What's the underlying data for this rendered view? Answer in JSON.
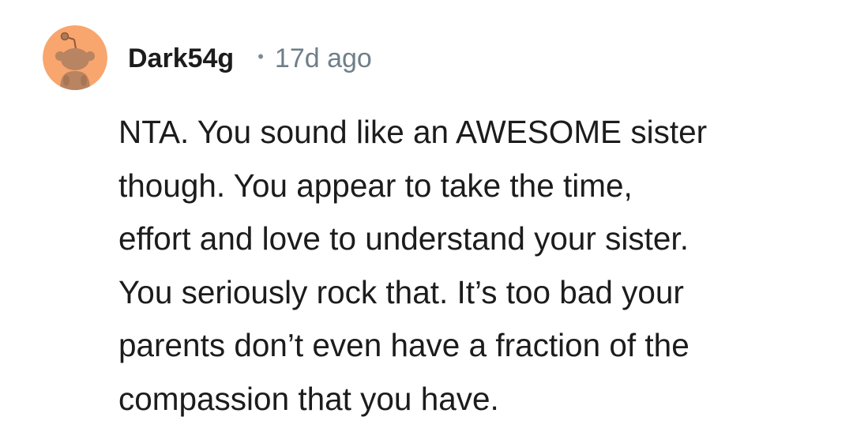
{
  "comment": {
    "author": "Dark54g",
    "separator": "•",
    "age": "17d ago",
    "avatar_icon": "snoo-avatar-icon",
    "avatar_color": "#f8a56e",
    "body_lines": [
      "NTA. You sound like an AWESOME sister",
      "though. You appear to take the time,",
      "effort and love to understand your sister.",
      "You seriously rock that. It’s too bad your",
      "parents don’t even have a fraction of the",
      "compassion that you have."
    ]
  }
}
